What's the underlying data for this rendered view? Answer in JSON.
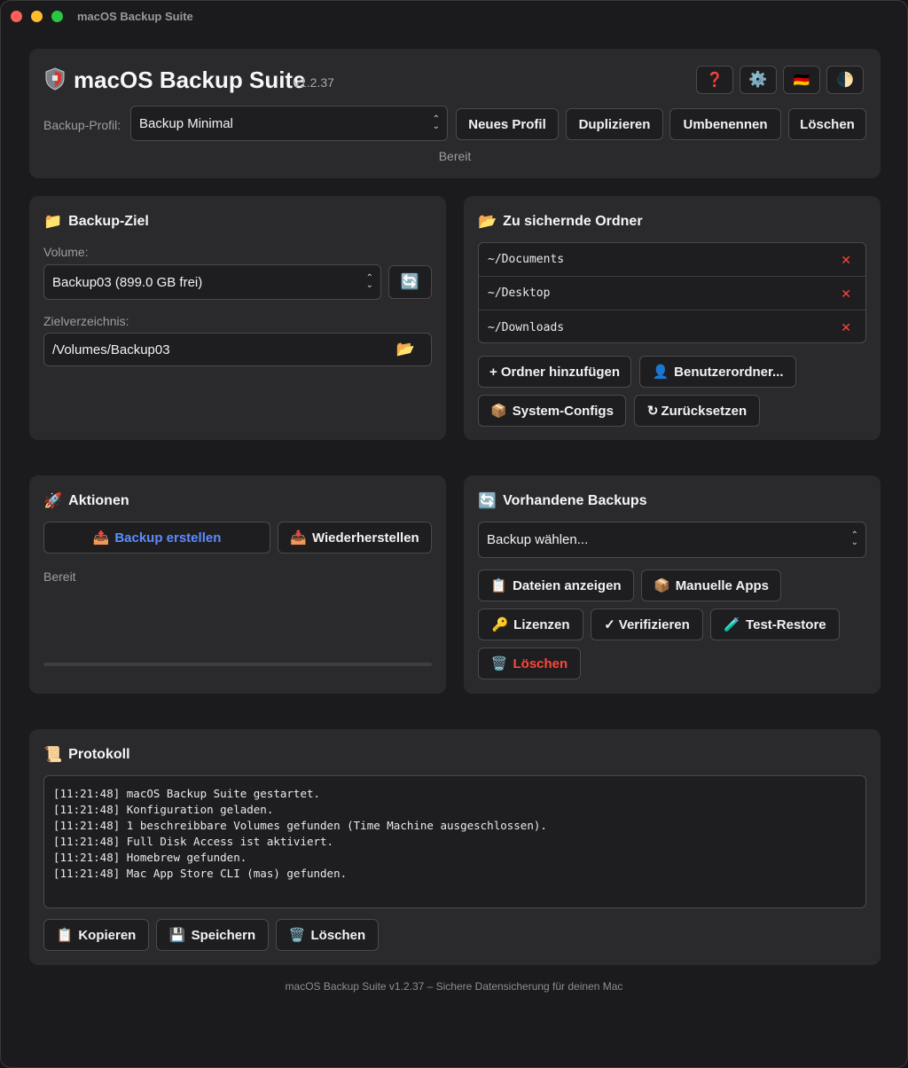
{
  "window": {
    "title": "macOS Backup Suite"
  },
  "header": {
    "app_icon": "shield-icon",
    "app_name": "macOS Backup Suite",
    "version": "v1.2.37",
    "icon_buttons": [
      {
        "name": "help",
        "glyph": "❓"
      },
      {
        "name": "settings",
        "glyph": "⚙️"
      },
      {
        "name": "language",
        "glyph": "🇩🇪"
      },
      {
        "name": "theme",
        "glyph": "🌓"
      }
    ],
    "profile_label": "Backup-Profil:",
    "profile_value": "Backup Minimal",
    "buttons": {
      "new": "Neues Profil",
      "duplicate": "Duplizieren",
      "rename": "Umbenennen",
      "delete": "Löschen"
    },
    "status": "Bereit"
  },
  "target": {
    "icon": "📁",
    "title": "Backup-Ziel",
    "volume_label": "Volume:",
    "volume_value": "Backup03 (899.0 GB frei)",
    "refresh_glyph": "🔄",
    "dir_label": "Zielverzeichnis:",
    "dir_value": "/Volumes/Backup03",
    "folder_glyph": "📂"
  },
  "folders": {
    "icon": "📂",
    "title": "Zu sichernde Ordner",
    "items": [
      "~/Documents",
      "~/Desktop",
      "~/Downloads"
    ],
    "remove_glyph": "✕",
    "buttons": {
      "add": "+ Ordner hinzufügen",
      "user_icon": "👤",
      "user": "Benutzerordner...",
      "sys_icon": "📦",
      "sys": "System-Configs",
      "reset_icon": "↻",
      "reset": "Zurücksetzen"
    }
  },
  "actions": {
    "icon": "🚀",
    "title": "Aktionen",
    "backup_icon": "📤",
    "backup": "Backup erstellen",
    "restore_icon": "📥",
    "restore": "Wiederherstellen",
    "status": "Bereit",
    "progress": 0
  },
  "backups": {
    "icon": "🔄",
    "title": "Vorhandene Backups",
    "select_value": "Backup wählen...",
    "buttons": {
      "files_icon": "📋",
      "files": "Dateien anzeigen",
      "apps_icon": "📦",
      "apps": "Manuelle Apps",
      "lic_icon": "🔑",
      "lic": "Lizenzen",
      "verify_icon": "✓",
      "verify": "Verifizieren",
      "test_icon": "🧪",
      "test": "Test-Restore",
      "del_icon": "🗑️",
      "del": "Löschen"
    }
  },
  "log": {
    "icon": "📜",
    "title": "Protokoll",
    "lines": [
      "[11:21:48] macOS Backup Suite gestartet.",
      "[11:21:48] Konfiguration geladen.",
      "[11:21:48] 1 beschreibbare Volumes gefunden (Time Machine ausgeschlossen).",
      "[11:21:48] Full Disk Access ist aktiviert.",
      "[11:21:48] Homebrew gefunden.",
      "[11:21:48] Mac App Store CLI (mas) gefunden."
    ],
    "buttons": {
      "copy_icon": "📋",
      "copy": "Kopieren",
      "save_icon": "💾",
      "save": "Speichern",
      "clear_icon": "🗑️",
      "clear": "Löschen"
    }
  },
  "footer": "macOS Backup Suite v1.2.37 – Sichere Datensicherung für deinen Mac",
  "colors": {
    "accent": "#5b8cff",
    "danger": "#ff453a",
    "panel": "#2a2a2c",
    "background": "#1b1b1d"
  }
}
